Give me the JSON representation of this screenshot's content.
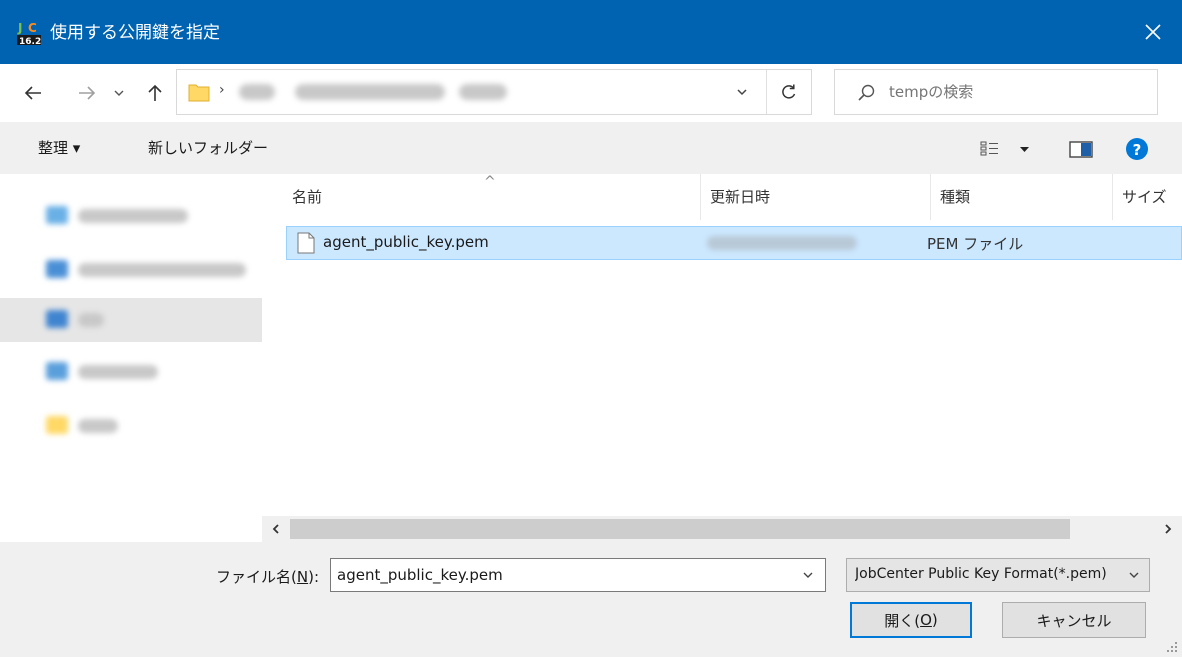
{
  "window": {
    "title": "使用する公開鍵を指定",
    "app_icon": "jobcenter-icon",
    "close_icon": "close-icon"
  },
  "address": {
    "separator": "›",
    "search_placeholder": "tempの検索"
  },
  "toolbar": {
    "organize_label": "整理 ▾",
    "new_folder_label": "新しいフォルダー"
  },
  "file_list": {
    "columns": [
      "名前",
      "更新日時",
      "種類",
      "サイズ"
    ],
    "rows": [
      {
        "name": "agent_public_key.pem",
        "type": "PEM ファイル"
      }
    ]
  },
  "bottom": {
    "filename_label_pre": "ファイル名(",
    "filename_label_key": "N",
    "filename_label_post": "):",
    "filename_value": "agent_public_key.pem",
    "filetype_value": "JobCenter Public Key Format(*.pem)",
    "open_label_pre": "開く(",
    "open_label_key": "O",
    "open_label_post": ")",
    "cancel_label": "キャンセル"
  },
  "colors": {
    "titlebar": "#0063b1",
    "selection": "#cce8ff",
    "help": "#0078d7"
  }
}
